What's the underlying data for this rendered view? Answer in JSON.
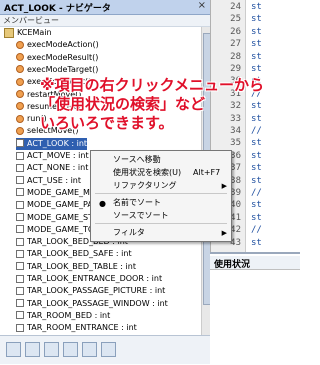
{
  "navigator": {
    "title": "ACT_LOOK - ナビゲータ",
    "close_glyph": "×",
    "subheader": "メンバービュー",
    "tree": [
      {
        "label": "KCEMain",
        "kind": "root"
      },
      {
        "label": "execModeAction()",
        "kind": "method"
      },
      {
        "label": "execModeResult()",
        "kind": "method"
      },
      {
        "label": "execModeTarget()",
        "kind": "method"
      },
      {
        "label": "execModeWait()",
        "kind": "method"
      },
      {
        "label": "restartMove()",
        "kind": "method"
      },
      {
        "label": "resumeMove()",
        "kind": "method"
      },
      {
        "label": "run()",
        "kind": "method"
      },
      {
        "label": "selectMove()",
        "kind": "method"
      },
      {
        "label": "ACT_LOOK : int",
        "kind": "field",
        "selected": true
      },
      {
        "label": "ACT_MOVE : int",
        "kind": "field"
      },
      {
        "label": "ACT_NONE : int",
        "kind": "field"
      },
      {
        "label": "ACT_USE : int",
        "kind": "field"
      },
      {
        "label": "MODE_GAME_MAP : int",
        "kind": "field"
      },
      {
        "label": "MODE_GAME_PASS : int",
        "kind": "field"
      },
      {
        "label": "MODE_GAME_START : int",
        "kind": "field"
      },
      {
        "label": "MODE_GAME_TOP : int",
        "kind": "field"
      },
      {
        "label": "TAR_LOOK_BED_BED : int",
        "kind": "field"
      },
      {
        "label": "TAR_LOOK_BED_SAFE : int",
        "kind": "field"
      },
      {
        "label": "TAR_LOOK_BED_TABLE : int",
        "kind": "field"
      },
      {
        "label": "TAR_LOOK_ENTRANCE_DOOR : int",
        "kind": "field"
      },
      {
        "label": "TAR_LOOK_PASSAGE_PICTURE : int",
        "kind": "field"
      },
      {
        "label": "TAR_LOOK_PASSAGE_WINDOW : int",
        "kind": "field"
      },
      {
        "label": "TAR_ROOM_BED : int",
        "kind": "field"
      },
      {
        "label": "TAR_ROOM_ENTRANCE : int",
        "kind": "field"
      }
    ],
    "toolbar_icons": [
      "filter-fields-icon",
      "filter-static-icon",
      "filter-private-icon",
      "filter-inherited-icon",
      "sort-name-icon",
      "sort-source-icon"
    ]
  },
  "context_menu": {
    "items": [
      {
        "label": "ソースへ移動",
        "shortcut": "",
        "submenu": false
      },
      {
        "label": "使用状況を検索(U)",
        "shortcut": "Alt+F7",
        "submenu": false
      },
      {
        "label": "リファクタリング",
        "shortcut": "",
        "submenu": true
      },
      {
        "label": "名前でソート",
        "shortcut": "",
        "submenu": false,
        "radio": true
      },
      {
        "label": "ソースでソート",
        "shortcut": "",
        "submenu": false
      },
      {
        "label": "フィルタ",
        "shortcut": "",
        "submenu": true
      }
    ],
    "radio_glyph": "●",
    "submenu_glyph": "▶"
  },
  "editor": {
    "line_numbers": [
      "24",
      "25",
      "26",
      "27",
      "28",
      "29",
      "30",
      "31",
      "32",
      "33",
      "34",
      "35",
      "36",
      "37",
      "38",
      "39",
      "40",
      "41",
      "42",
      "43"
    ],
    "code_prefix": [
      "st",
      "st",
      "st",
      "st",
      "st",
      "st",
      "st",
      "//",
      "st",
      "st",
      "//",
      "st",
      "st",
      "st",
      "st",
      "//",
      "st",
      "st",
      "//",
      "st"
    ]
  },
  "usage_panel": {
    "title": "使用状況"
  },
  "overlay": {
    "line1": "※項目の右クリックメニューから",
    "line2": "「使用状況の検索」など",
    "line3": "いろいろできます。"
  },
  "colors": {
    "selection": "#2f5fb0",
    "overlay_text": "#e0102a",
    "titlebar": "#c0d2ec"
  }
}
